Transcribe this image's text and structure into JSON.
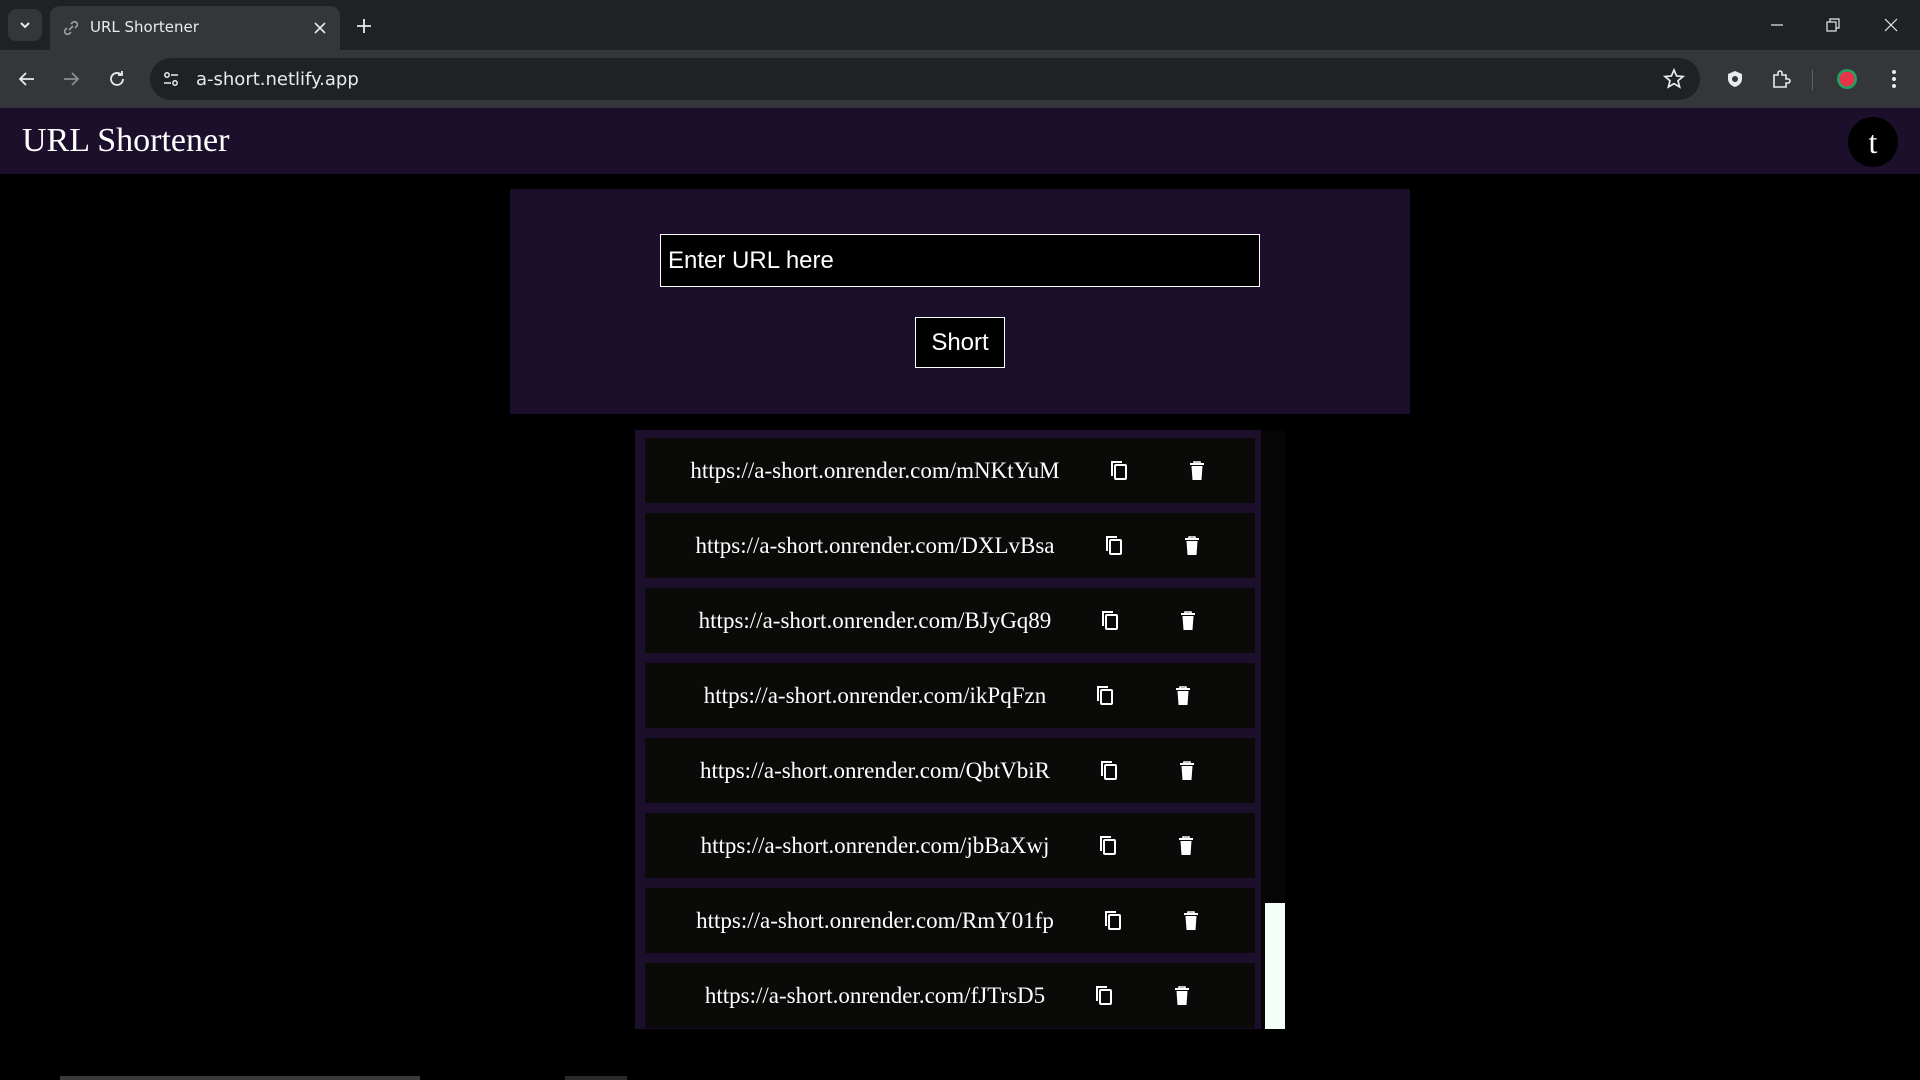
{
  "browser": {
    "tab_title": "URL Shortener",
    "url": "a-short.netlify.app"
  },
  "app": {
    "title": "URL Shortener",
    "avatar_letter": "t",
    "input_placeholder": "Enter URL here",
    "input_value": "",
    "short_button": "Short"
  },
  "links": [
    {
      "url": "https://a-short.onrender.com/mNKtYuM"
    },
    {
      "url": "https://a-short.onrender.com/DXLvBsa"
    },
    {
      "url": "https://a-short.onrender.com/BJyGq89"
    },
    {
      "url": "https://a-short.onrender.com/ikPqFzn"
    },
    {
      "url": "https://a-short.onrender.com/QbtVbiR"
    },
    {
      "url": "https://a-short.onrender.com/jbBaXwj"
    },
    {
      "url": "https://a-short.onrender.com/RmY01fp"
    },
    {
      "url": "https://a-short.onrender.com/fJTrsD5"
    }
  ],
  "icons": {
    "copy": "copy-icon",
    "delete": "trash-icon"
  },
  "colors": {
    "page_bg": "#000000",
    "panel_bg": "#1b0f2b",
    "row_bg": "#0a0a08",
    "text": "#ffffff",
    "scroll_thumb": "#f4fff7"
  }
}
